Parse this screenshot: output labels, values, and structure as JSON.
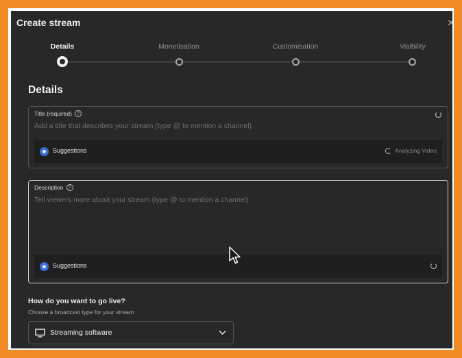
{
  "dialog": {
    "title": "Create stream",
    "close_glyph": "✕"
  },
  "stepper": {
    "steps": [
      {
        "label": "Details",
        "state": "active"
      },
      {
        "label": "Monetisation",
        "state": "inactive"
      },
      {
        "label": "Customisation",
        "state": "inactive"
      },
      {
        "label": "Visibility",
        "state": "inactive"
      }
    ]
  },
  "details": {
    "section_title": "Details",
    "title_field": {
      "label": "Title (required)",
      "placeholder": "Add a title that describes your stream (type @ to mention a channel)",
      "suggestions_label": "Suggestions",
      "analyzing_label": "Analyzing Video"
    },
    "description_field": {
      "label": "Description",
      "placeholder": "Tell viewers more about your stream (type @ to mention a channel)",
      "suggestions_label": "Suggestions"
    },
    "help_glyph": "?"
  },
  "go_live": {
    "title": "How do you want to go live?",
    "subtitle": "Choose a broadcast type for your stream",
    "selected": "Streaming software"
  },
  "colors": {
    "frame_orange": "#f08a24",
    "dialog_bg": "#282828",
    "suggest_bg": "#1f1f1f",
    "accent_blue": "#3b6fd8"
  },
  "icons": {
    "close": "close-icon",
    "help": "help-icon",
    "spinner": "spinner-icon",
    "suggestions": "suggestions-icon",
    "monitor": "monitor-icon",
    "chevron": "chevron-down-icon",
    "cursor": "mouse-cursor-icon"
  }
}
